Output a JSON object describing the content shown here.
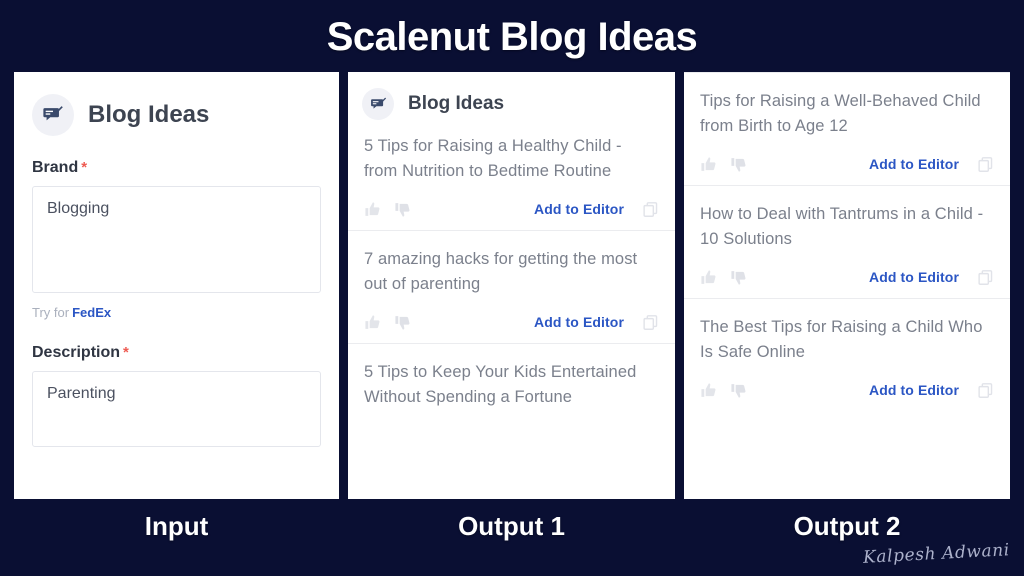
{
  "header": {
    "title": "Scalenut Blog Ideas"
  },
  "colors": {
    "background": "#0a0f33",
    "panel": "#ffffff",
    "accent_blue": "#2b56c4",
    "required_red": "#ee5b52",
    "idea_text": "#7b808c",
    "label_text": "#2f3542"
  },
  "input_panel": {
    "card_title": "Blog Ideas",
    "icon": "chat-edit-icon",
    "brand": {
      "label": "Brand",
      "required_marker": "*",
      "value": "Blogging",
      "placeholder": "Brand"
    },
    "helper": {
      "prefix": "Try for",
      "brand_example": "FedEx"
    },
    "description": {
      "label": "Description",
      "required_marker": "*",
      "value": "Parenting",
      "placeholder": "Description"
    }
  },
  "output1_panel": {
    "card_title": "Blog Ideas",
    "icon": "chat-edit-icon",
    "action_label": "Add to Editor",
    "ideas": [
      "5 Tips for Raising a Healthy Child - from Nutrition to Bedtime Routine",
      "7 amazing hacks for getting the most out of parenting",
      "5 Tips to Keep Your Kids Entertained Without Spending a Fortune"
    ]
  },
  "output2_panel": {
    "action_label": "Add to Editor",
    "ideas": [
      "Tips for Raising a Well-Behaved Child from Birth to Age 12",
      "How to Deal with Tantrums in a Child - 10 Solutions",
      "The Best Tips for Raising a Child Who Is Safe Online"
    ]
  },
  "captions": {
    "input": "Input",
    "output1": "Output 1",
    "output2": "Output 2"
  },
  "signature": {
    "text": "Kalpesh Adwani"
  }
}
